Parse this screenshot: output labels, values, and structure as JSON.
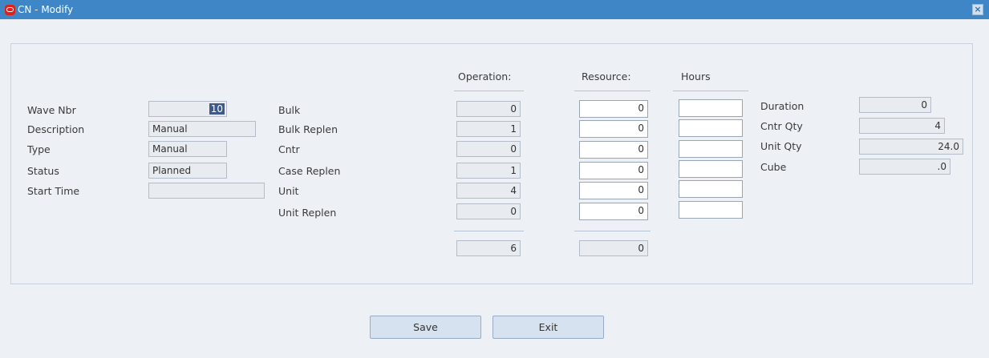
{
  "window": {
    "title": "CN - Modify",
    "close_icon": "close-icon",
    "logo_icon": "oracle-logo-icon"
  },
  "wave": {
    "wave_nbr": {
      "label": "Wave Nbr",
      "value": "10"
    },
    "description": {
      "label": "Description",
      "value": "Manual"
    },
    "type": {
      "label": "Type",
      "value": "Manual"
    },
    "status": {
      "label": "Status",
      "value": "Planned"
    },
    "start_time": {
      "label": "Start Time",
      "value": ""
    }
  },
  "columns": {
    "operations": "Operation:",
    "resources": "Resource:",
    "hours": "Hours"
  },
  "rows": [
    {
      "label": "Bulk",
      "operations": "0",
      "resources": "0",
      "hours": ""
    },
    {
      "label": "Bulk Replen",
      "operations": "1",
      "resources": "0",
      "hours": ""
    },
    {
      "label": "Cntr",
      "operations": "0",
      "resources": "0",
      "hours": ""
    },
    {
      "label": "Case Replen",
      "operations": "1",
      "resources": "0",
      "hours": ""
    },
    {
      "label": "Unit",
      "operations": "4",
      "resources": "0",
      "hours": ""
    },
    {
      "label": "Unit Replen",
      "operations": "0",
      "resources": "0",
      "hours": ""
    }
  ],
  "totals": {
    "operations": "6",
    "resources": "0"
  },
  "summary": {
    "duration": {
      "label": "Duration",
      "value": "0"
    },
    "cntr_qty": {
      "label": "Cntr Qty",
      "value": "4"
    },
    "unit_qty": {
      "label": "Unit Qty",
      "value": "24.0"
    },
    "cube": {
      "label": "Cube",
      "value": ".0"
    }
  },
  "buttons": {
    "save": "Save",
    "exit": "Exit"
  }
}
